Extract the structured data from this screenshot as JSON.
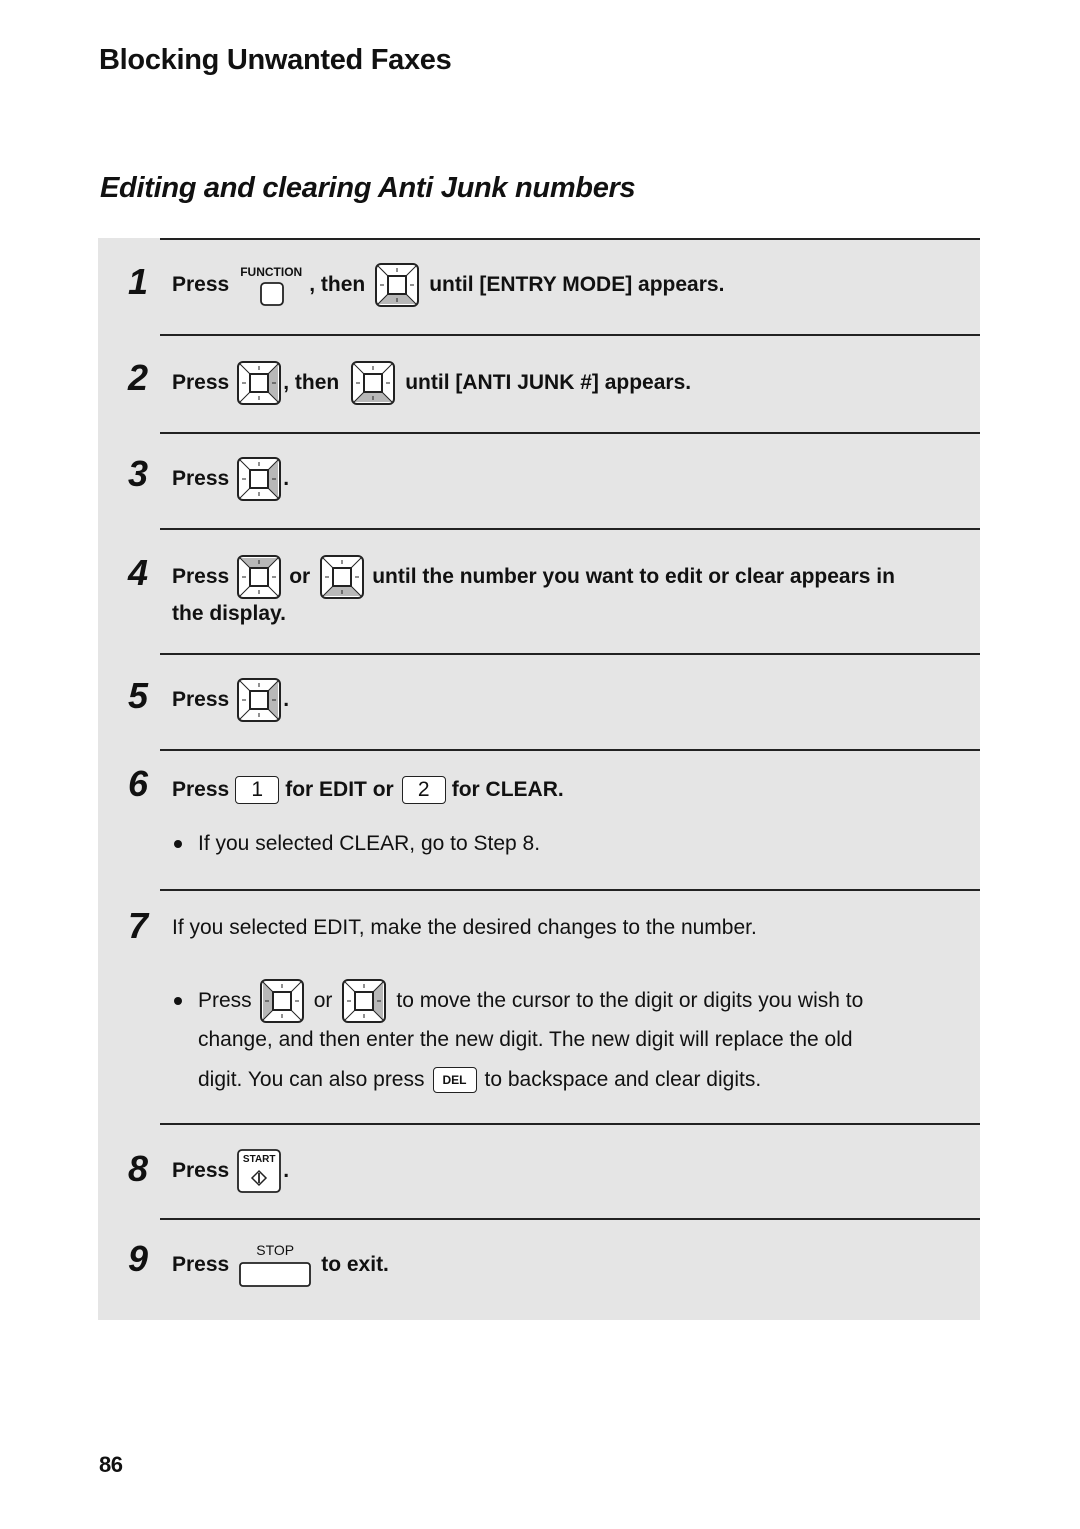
{
  "header": {
    "section_title": "Blocking Unwanted Faxes",
    "subsection_title": "Editing and clearing Anti Junk numbers"
  },
  "steps": [
    {
      "number": "1",
      "press": "Press",
      "key1": "FUNCTION",
      "then": ", then",
      "text": "until [ENTRY MODE] appears."
    },
    {
      "number": "2",
      "press": "Press",
      "then": ", then",
      "text": "until [ANTI JUNK #] appears."
    },
    {
      "number": "3",
      "press": "Press",
      "end": "."
    },
    {
      "number": "4",
      "press": "Press",
      "or": "or",
      "text": "until the number you want to edit or clear appears in",
      "text2": "the display."
    },
    {
      "number": "5",
      "press": "Press",
      "end": "."
    },
    {
      "number": "6",
      "press": "Press",
      "key1": "1",
      "mid": "for EDIT or",
      "key2": "2",
      "text": "for CLEAR.",
      "bullet": "If you selected CLEAR, go to Step 8."
    },
    {
      "number": "7",
      "text": "If you selected EDIT, make the desired changes to the number.",
      "bullet_press": "Press",
      "bullet_or": "or",
      "bullet_line1": "to move the cursor to the digit or digits you wish to",
      "bullet_line2": "change, and then enter the new digit. The new digit will replace the old",
      "bullet_line3a": "digit. You can also press",
      "del_key": "DEL",
      "bullet_line3b": "to backspace and clear digits."
    },
    {
      "number": "8",
      "press": "Press",
      "key1": "START",
      "end": "."
    },
    {
      "number": "9",
      "press": "Press",
      "key1": "STOP",
      "text": "to exit."
    }
  ],
  "icons": {
    "nav_key": "navigation-key-icon",
    "function_key": "function-key-icon",
    "start_key": "start-key-icon",
    "stop_key": "stop-key-icon"
  },
  "colors": {
    "panel_bg": "#e5e5e5",
    "key_highlight": "#b8b8b8"
  },
  "footer": {
    "page_number": "86"
  }
}
